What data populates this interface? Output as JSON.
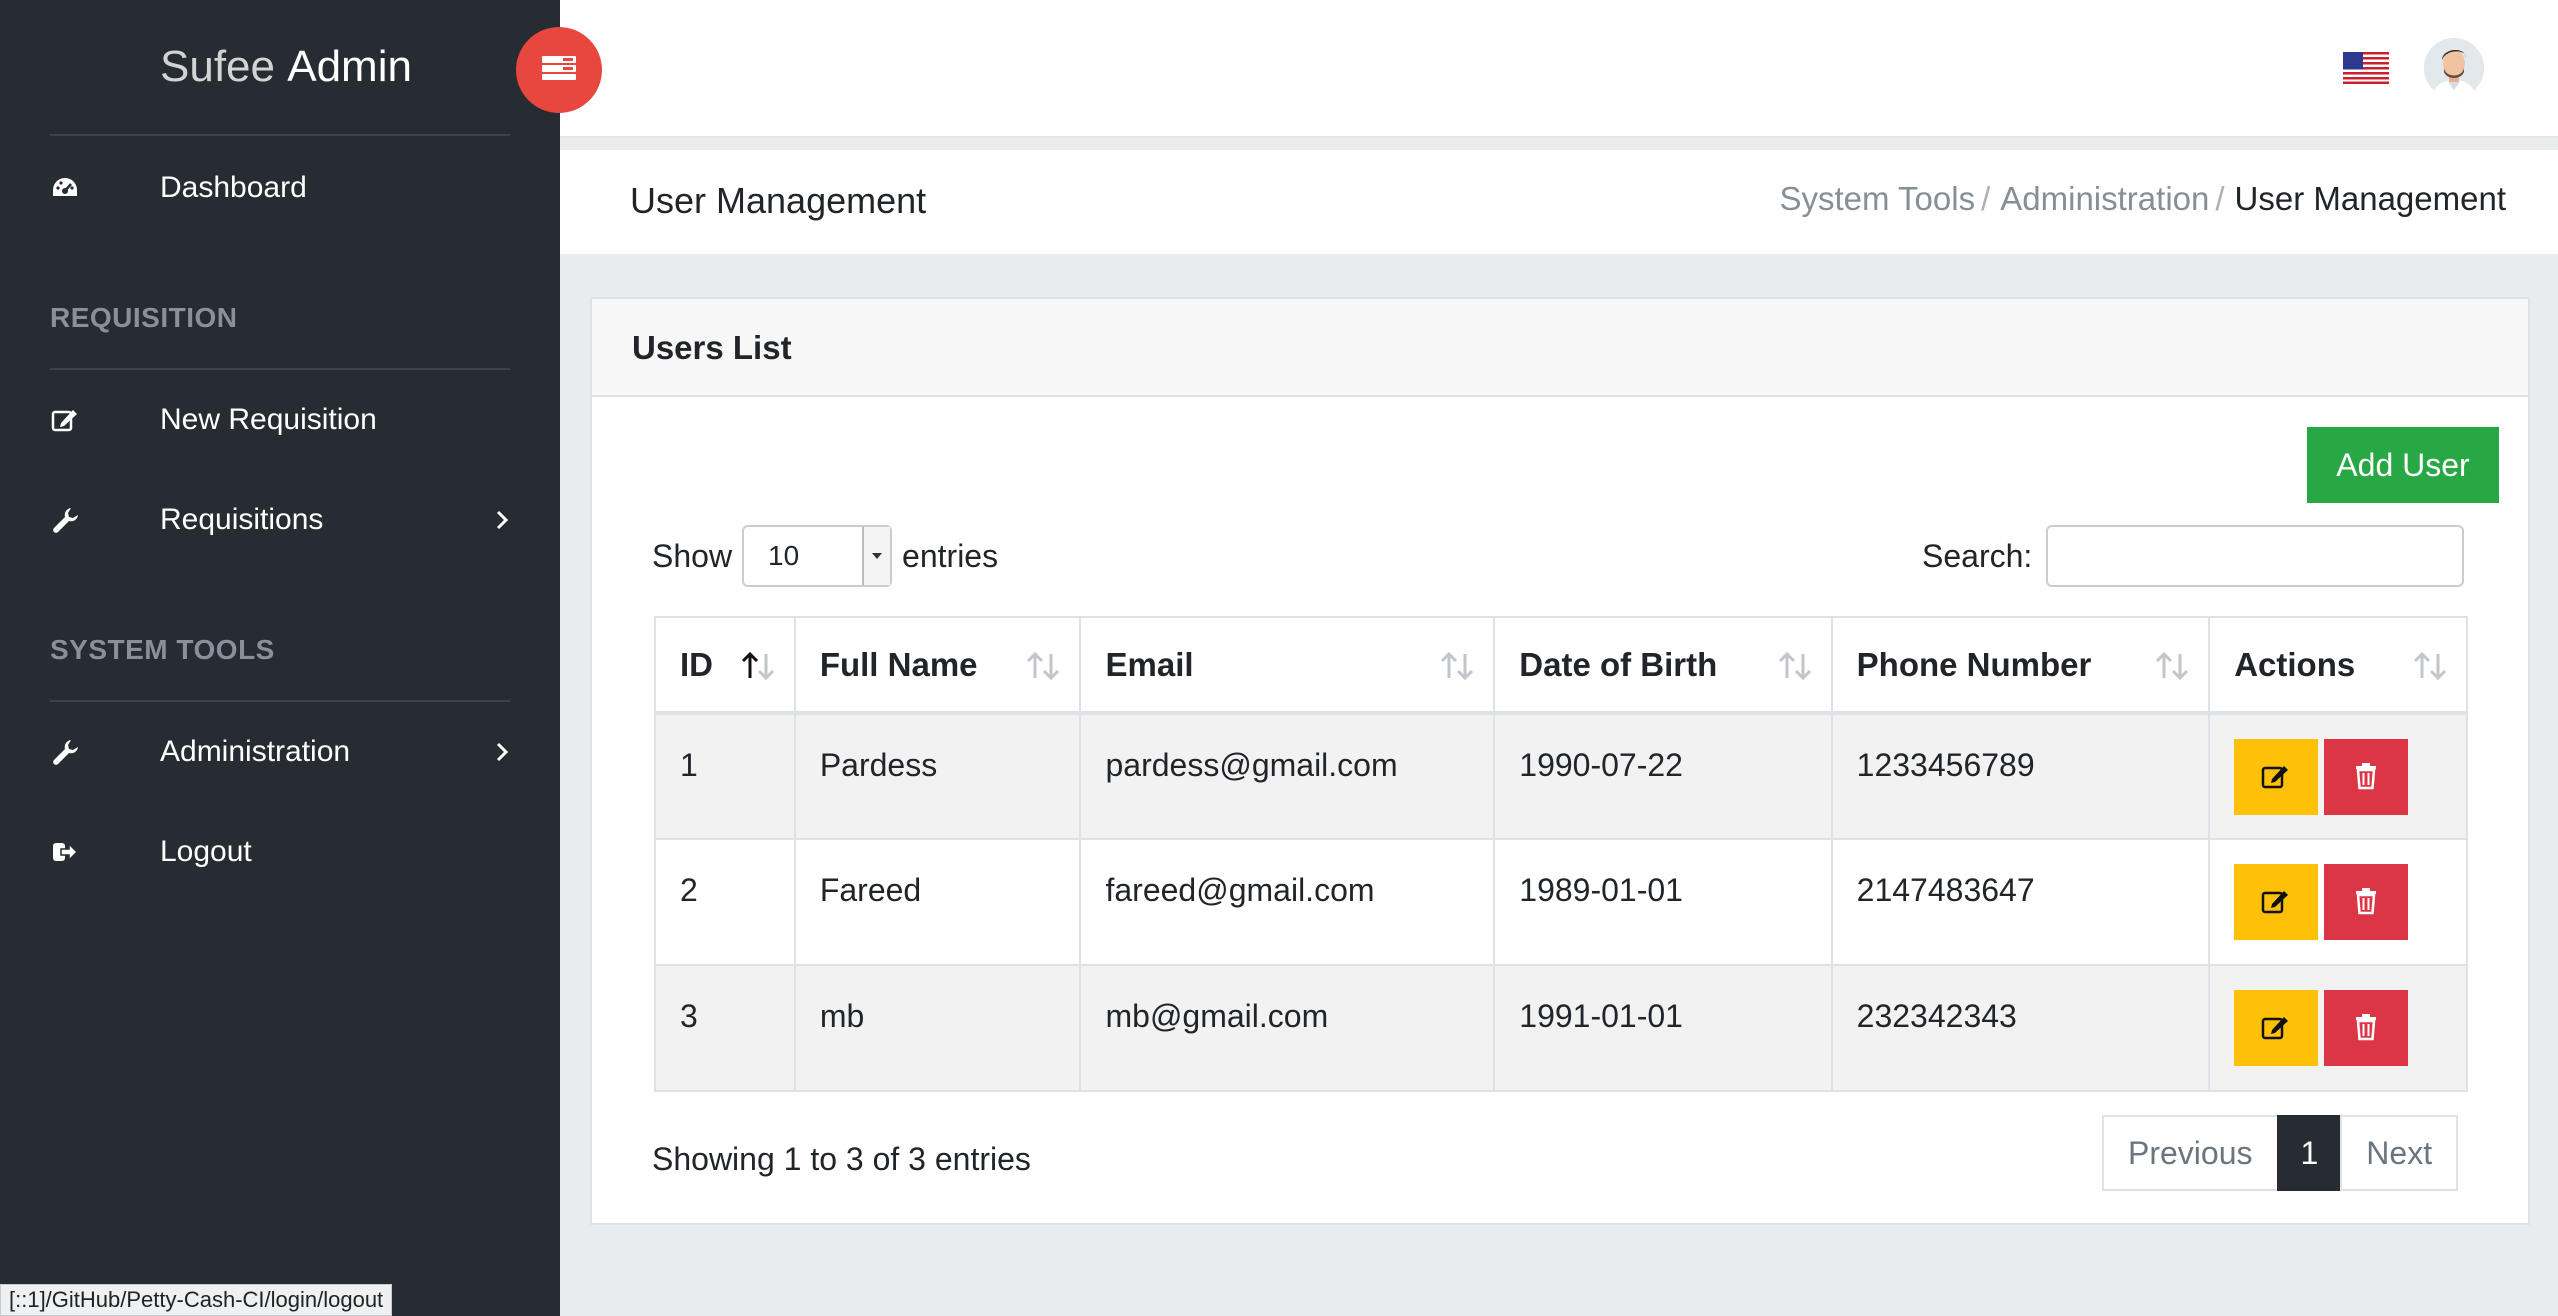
{
  "sidebar": {
    "brand_light": "Sufee",
    "brand_bold": "Admin",
    "items": [
      {
        "label": "Dashboard",
        "icon": "dashboard-icon"
      },
      {
        "label": "New Requisition",
        "icon": "edit-icon"
      },
      {
        "label": "Requisitions",
        "icon": "wrench-icon"
      },
      {
        "label": "Administration",
        "icon": "wrench-icon"
      },
      {
        "label": "Logout",
        "icon": "sign-out-icon"
      }
    ],
    "sections": [
      "REQUISITION",
      "SYSTEM TOOLS"
    ]
  },
  "status_url": "[::1]/GitHub/Petty-Cash-CI/login/logout",
  "page": {
    "title": "User Management",
    "breadcrumb": [
      "System Tools",
      "Administration",
      "User Management"
    ]
  },
  "card": {
    "title": "Users List",
    "add_user_label": "Add User",
    "show_label": "Show",
    "entries_label": "entries",
    "page_length": "10",
    "search_label": "Search:",
    "search_value": ""
  },
  "table": {
    "columns": [
      "ID",
      "Full Name",
      "Email",
      "Date of Birth",
      "Phone Number",
      "Actions"
    ],
    "rows": [
      {
        "id": "1",
        "name": "Pardess",
        "email": "pardess@gmail.com",
        "dob": "1990-07-22",
        "phone": "1233456789"
      },
      {
        "id": "2",
        "name": "Fareed",
        "email": "fareed@gmail.com",
        "dob": "1989-01-01",
        "phone": "2147483647"
      },
      {
        "id": "3",
        "name": "mb",
        "email": "mb@gmail.com",
        "dob": "1991-01-01",
        "phone": "232342343"
      }
    ]
  },
  "footer": {
    "info": "Showing 1 to 3 of 3 entries",
    "prev_label": "Previous",
    "current_page": "1",
    "next_label": "Next"
  },
  "colors": {
    "sidebar_bg": "#272c33",
    "toggle_red": "#e8473e",
    "success": "#28a745",
    "warning": "#ffc107",
    "danger": "#dc3545"
  }
}
